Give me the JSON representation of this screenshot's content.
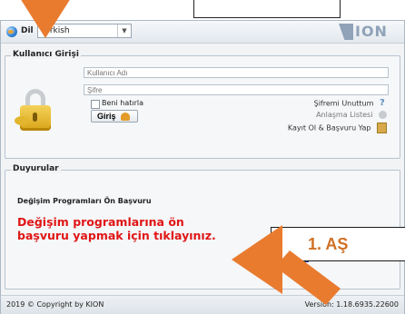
{
  "header": {
    "language_label": "Dil",
    "language_value": "Turkish",
    "logo_text": "ION"
  },
  "login": {
    "legend": "Kullanıcı Girişi",
    "username_placeholder": "Kullanıcı Adı",
    "password_placeholder": "Şifre",
    "remember_label": "Beni hatırla",
    "login_button": "Giriş",
    "forgot_password": "Şifremi Unuttum",
    "agreements": "Anlaşma Listesi",
    "register": "Kayıt Ol & Başvuru Yap"
  },
  "news": {
    "legend": "Duyurular",
    "title": "Değişim Programları Ön Başvuru",
    "message": "Değişim programlarına ön başvuru yapmak için tıklayınız."
  },
  "footer": {
    "copyright": "2019 © Copyright by KION",
    "version": "Version: 1.18.6935.22600"
  },
  "overlay": {
    "step_text": "1.   AŞ"
  },
  "colors": {
    "accent_orange": "#e97b2f",
    "news_red": "#e01515"
  }
}
